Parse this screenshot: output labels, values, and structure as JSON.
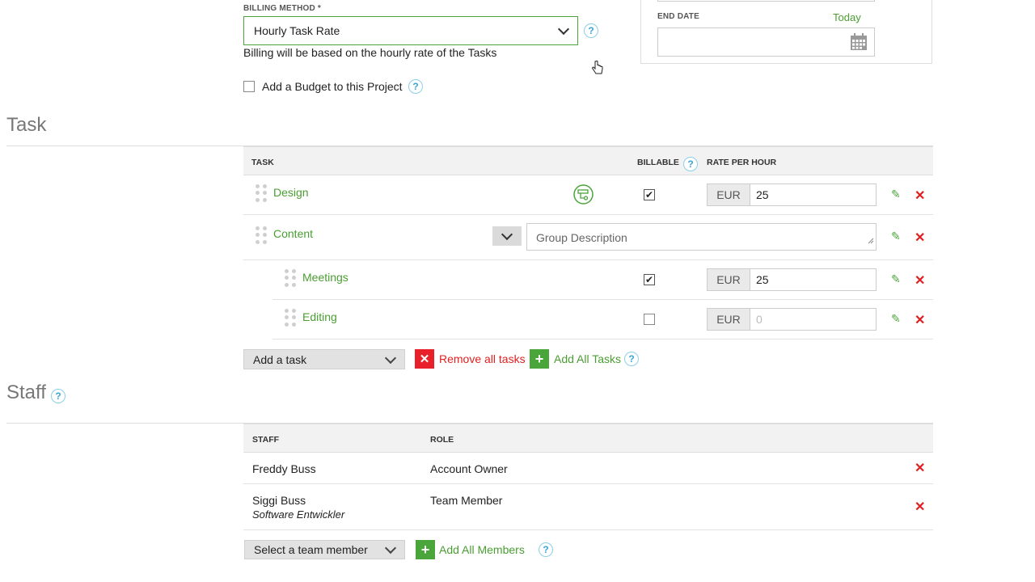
{
  "billing": {
    "label": "BILLING METHOD *",
    "selected": "Hourly Task Rate",
    "description": "Billing will be based on the hourly rate of the Tasks",
    "budget_checkbox_label": "Add a Budget to this Project",
    "help_glyph": "?"
  },
  "dates": {
    "end_label": "END DATE",
    "today_link": "Today",
    "end_value": ""
  },
  "task_section": {
    "title": "Task",
    "headers": {
      "task": "TASK",
      "billable": "BILLABLE",
      "rate": "RATE PER HOUR"
    },
    "rows": [
      {
        "name": "Design",
        "billable": true,
        "currency": "EUR",
        "rate": "25"
      },
      {
        "name": "Content",
        "group_description_placeholder": "Group Description"
      },
      {
        "name": "Meetings",
        "billable": true,
        "currency": "EUR",
        "rate": "25"
      },
      {
        "name": "Editing",
        "billable": false,
        "currency": "EUR",
        "rate": "0"
      }
    ],
    "add_task": "Add a task",
    "remove_all": "Remove all tasks",
    "add_all": "Add All Tasks"
  },
  "staff_section": {
    "title": "Staff",
    "headers": {
      "staff": "STAFF",
      "role": "ROLE"
    },
    "members": [
      {
        "name": "Freddy Buss",
        "subtitle": "",
        "role": "Account Owner"
      },
      {
        "name": "Siggi Buss",
        "subtitle": "Software Entwickler",
        "role": "Team Member"
      }
    ],
    "select_member": "Select a team member",
    "add_all": "Add All Members"
  },
  "glyphs": {
    "check": "✔",
    "pencil": "✎",
    "close": "✕",
    "plus": "+",
    "times_box": "✕"
  },
  "colors": {
    "accent_green": "#4aa63a",
    "danger_red": "#e02020",
    "help_blue": "#3aa6d6"
  }
}
